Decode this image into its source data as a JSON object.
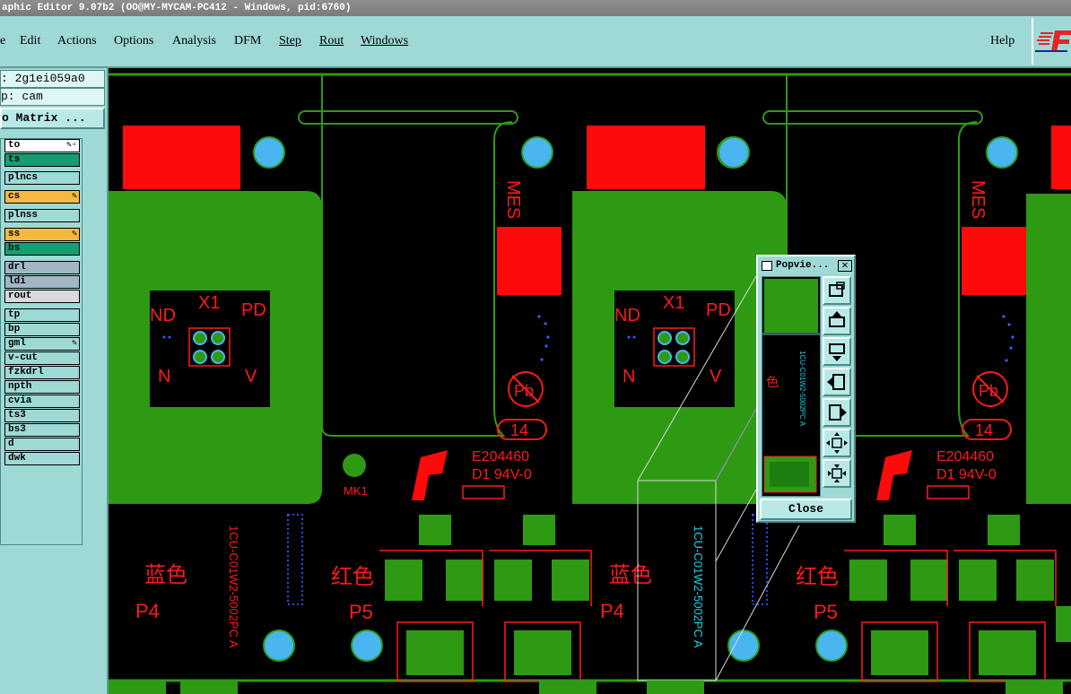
{
  "window": {
    "title": "aphic Editor 9.07b2 (OO@MY-MYCAM-PC412 - Windows, pid:6760)"
  },
  "menu": {
    "items": [
      {
        "label": "e"
      },
      {
        "label": "Edit"
      },
      {
        "label": "Actions"
      },
      {
        "label": "Options"
      },
      {
        "label": "Analysis"
      },
      {
        "label": "DFM"
      },
      {
        "label": "Step"
      },
      {
        "label": "Rout"
      },
      {
        "label": "Windows"
      }
    ],
    "help_label": "Help"
  },
  "sidebar": {
    "job_value": ": 2g1ei059a0",
    "step_value": "p: cam",
    "matrix_button": "o Matrix ...",
    "layers": [
      {
        "name": "to",
        "state": "active",
        "mark": "✎▫",
        "color": "#ffffff"
      },
      {
        "name": "ts",
        "state": "affected",
        "mark": "",
        "color": "#139f73"
      },
      {
        "name": "plncs",
        "state": "normal",
        "mark": "",
        "color": "#9ed9d6"
      },
      {
        "name": "cs",
        "state": "selected",
        "mark": "✎",
        "color": "#f5b942"
      },
      {
        "name": "plnss",
        "state": "normal",
        "mark": "",
        "color": "#9ed9d6"
      },
      {
        "name": "ss",
        "state": "selected",
        "mark": "✎",
        "color": "#f5b942"
      },
      {
        "name": "bs",
        "state": "affected",
        "mark": "",
        "color": "#139f73"
      },
      {
        "name": "drl",
        "state": "drill",
        "mark": "",
        "color": "#9fb7c4"
      },
      {
        "name": "ldi",
        "state": "drill",
        "mark": "",
        "color": "#9fb7c4"
      },
      {
        "name": "rout",
        "state": "rout",
        "mark": "",
        "color": "#d9d9d9"
      },
      {
        "name": "tp",
        "state": "normal",
        "mark": "",
        "color": "#9ed9d6"
      },
      {
        "name": "bp",
        "state": "normal",
        "mark": "",
        "color": "#9ed9d6"
      },
      {
        "name": "gml",
        "state": "normal",
        "mark": "✎",
        "color": "#9ed9d6"
      },
      {
        "name": "v-cut",
        "state": "normal",
        "mark": "",
        "color": "#9ed9d6"
      },
      {
        "name": "fzkdrl",
        "state": "normal",
        "mark": "",
        "color": "#9ed9d6"
      },
      {
        "name": "npth",
        "state": "normal",
        "mark": "",
        "color": "#9ed9d6"
      },
      {
        "name": "cvia",
        "state": "normal",
        "mark": "",
        "color": "#9ed9d6"
      },
      {
        "name": "ts3",
        "state": "normal",
        "mark": "",
        "color": "#9ed9d6"
      },
      {
        "name": "bs3",
        "state": "normal",
        "mark": "",
        "color": "#9ed9d6"
      },
      {
        "name": "d",
        "state": "normal",
        "mark": "",
        "color": "#9ed9d6"
      },
      {
        "name": "dwk",
        "state": "normal",
        "mark": "",
        "color": "#9ed9d6"
      }
    ]
  },
  "board": {
    "labels": {
      "x1": "X1",
      "nd": "ND",
      "pd": "PD",
      "n": "N",
      "v": "V",
      "mes": "MES",
      "pb": "Pb",
      "num14": "14",
      "ul_code": "E204460",
      "ul_grade": "D1  94V-0",
      "mk1": "MK1",
      "blue_cn": "蓝色",
      "red_cn": "红色",
      "p4": "P4",
      "p5": "P5",
      "part_no": "1CU-C01W2-5002PC  A",
      "color_char": "色"
    },
    "colors": {
      "copper": "#2e9a14",
      "mask": "#ff0a0a",
      "drill": "#49b6f0",
      "outline": "#2e9a14",
      "text": "#ff1a1a",
      "cyan": "#19d3e8",
      "bg": "#000000"
    }
  },
  "popview": {
    "title": "Popvie...",
    "close_label": "Close",
    "buttons": [
      "zoom-fit-icon",
      "pan-up-icon",
      "pan-down-icon",
      "pan-left-icon",
      "pan-right-icon",
      "zoom-out-icon",
      "zoom-in-icon"
    ]
  }
}
